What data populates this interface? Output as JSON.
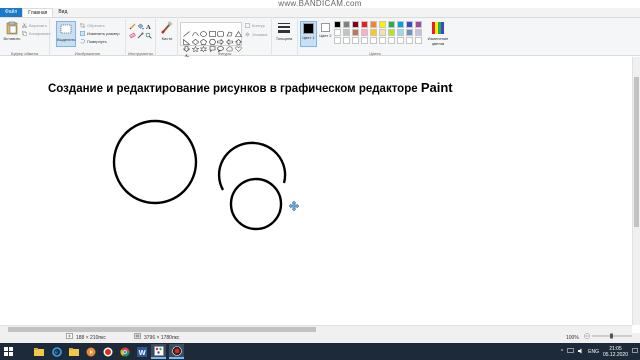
{
  "watermark": "www.BANDICAM.com",
  "tabs": {
    "file": "Файл",
    "home": "Главная",
    "view": "Вид"
  },
  "ribbon": {
    "clipboard": {
      "label": "Буфер обмена",
      "paste": "Вставить",
      "cut": "Вырезать",
      "copy": "Копировать"
    },
    "image": {
      "label": "Изображение",
      "select": "Выделить",
      "crop": "Обрезать",
      "resize": "Изменить размер",
      "rotate": "Повернуть"
    },
    "tools": {
      "label": "Инструменты"
    },
    "brushes": {
      "label": "Кисти"
    },
    "shapes": {
      "label": "Фигуры",
      "outline": "Контур",
      "fill": "Заливка"
    },
    "size": {
      "label": "Толщина"
    },
    "colors": {
      "label": "Цвета",
      "color1": "Цвет 1",
      "color2": "Цвет 2",
      "edit": "Изменение цветов",
      "palette_row1": [
        "#000000",
        "#7f7f7f",
        "#880015",
        "#ed1c24",
        "#ff7f27",
        "#fff200",
        "#22b14c",
        "#00a2e8",
        "#3f48cc",
        "#a349a4"
      ],
      "palette_row2": [
        "#ffffff",
        "#c3c3c3",
        "#b97a57",
        "#ffaec9",
        "#ffc90e",
        "#efe4b0",
        "#b5e61d",
        "#99d9ea",
        "#7092be",
        "#c8bfe7"
      ]
    }
  },
  "canvas": {
    "title": "Создание и редактирование рисунков в графическом редакторе",
    "title_brand": "Paint"
  },
  "status": {
    "cursor": "188 × 210пкс",
    "canvas_size": "3796 × 1780пкс",
    "zoom": "100%"
  },
  "taskbar": {
    "lang": "ENG",
    "time": "21:05",
    "date": "05.12.2020"
  }
}
